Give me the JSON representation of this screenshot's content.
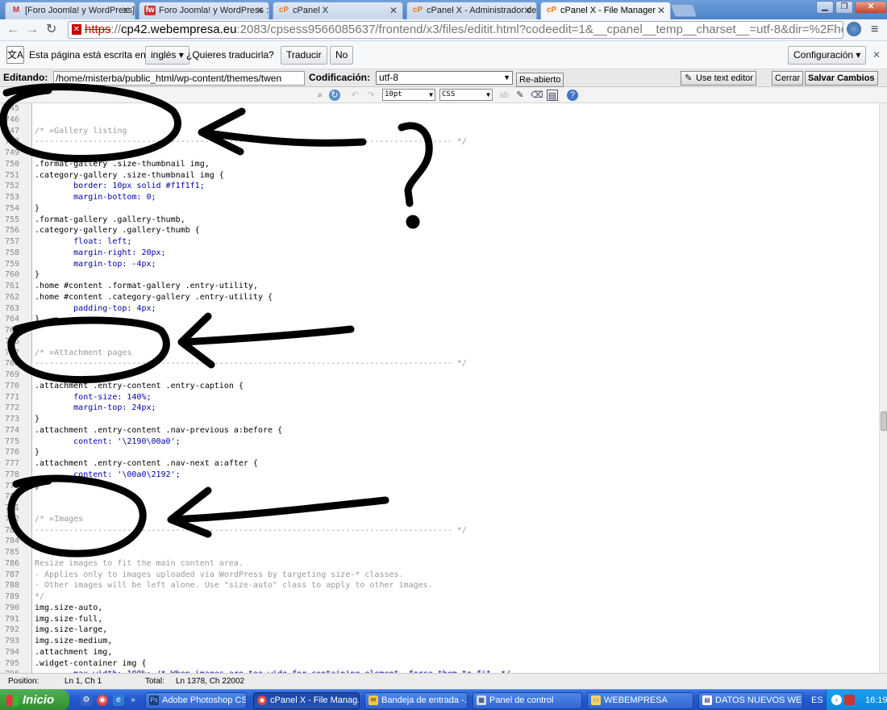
{
  "browser": {
    "tabs": [
      {
        "label": "[Foro Joomla! y WordPress]",
        "favicon": "gmail-icon"
      },
      {
        "label": "Foro Joomla! y WordPress ::",
        "favicon": "forum-icon"
      },
      {
        "label": "cPanel X",
        "favicon": "cpanel-icon"
      },
      {
        "label": "cPanel X - Administrador de /",
        "favicon": "cpanel-icon"
      },
      {
        "label": "cPanel X - File Manager",
        "favicon": "cpanel-icon"
      }
    ],
    "url": {
      "scheme": "https",
      "rest_before_host": "://",
      "host": "cp42.webempresa.eu",
      "path": ":2083/cpsess9566085637/frontend/x3/files/editit.html?codeedit=1&__cpanel__temp__charset__=utf-8&dir=%2Fhome%"
    }
  },
  "translate": {
    "message": "Esta página está escrita en",
    "language": "inglés",
    "question": "¿Quieres traducirla?",
    "translate_button": "Traducir",
    "no_button": "No",
    "config_button": "Configuración"
  },
  "editor_header": {
    "editing_label": "Editando:",
    "path": "/home/misterba/public_html/wp-content/themes/twen",
    "encoding_label": "Codificación:",
    "encoding": "utf-8",
    "reopen_button": "Re-abierto",
    "use_text_editor_button": "Use text editor",
    "close_button": "Cerrar",
    "save_button": "Salvar Cambios"
  },
  "toolbar": {
    "font_size": "10pt",
    "syntax": "CSS"
  },
  "code_lines": [
    {
      "n": "745",
      "t": "",
      "cls": ""
    },
    {
      "n": "746",
      "t": "",
      "cls": ""
    },
    {
      "n": "747",
      "t": "/* =Gallery listing",
      "cls": "c"
    },
    {
      "n": "748",
      "t": "-------------------------------------------------------------------------------------- */",
      "cls": "c"
    },
    {
      "n": "749",
      "t": "",
      "cls": ""
    },
    {
      "n": "750",
      "t": ".format-gallery .size-thumbnail img,",
      "cls": ""
    },
    {
      "n": "751",
      "t": ".category-gallery .size-thumbnail img {",
      "cls": ""
    },
    {
      "n": "752",
      "t": "        border: 10px solid #f1f1f1;",
      "cls": "p"
    },
    {
      "n": "753",
      "t": "        margin-bottom: 0;",
      "cls": "p"
    },
    {
      "n": "754",
      "t": "}",
      "cls": ""
    },
    {
      "n": "755",
      "t": ".format-gallery .gallery-thumb,",
      "cls": ""
    },
    {
      "n": "756",
      "t": ".category-gallery .gallery-thumb {",
      "cls": ""
    },
    {
      "n": "757",
      "t": "        float: left;",
      "cls": "p"
    },
    {
      "n": "758",
      "t": "        margin-right: 20px;",
      "cls": "p"
    },
    {
      "n": "759",
      "t": "        margin-top: -4px;",
      "cls": "p"
    },
    {
      "n": "760",
      "t": "}",
      "cls": ""
    },
    {
      "n": "761",
      "t": ".home #content .format-gallery .entry-utility,",
      "cls": ""
    },
    {
      "n": "762",
      "t": ".home #content .category-gallery .entry-utility {",
      "cls": ""
    },
    {
      "n": "763",
      "t": "        padding-top: 4px;",
      "cls": "p"
    },
    {
      "n": "764",
      "t": "}",
      "cls": ""
    },
    {
      "n": "765",
      "t": "",
      "cls": ""
    },
    {
      "n": "766",
      "t": "",
      "cls": ""
    },
    {
      "n": "767",
      "t": "/* =Attachment pages",
      "cls": "c"
    },
    {
      "n": "768",
      "t": "-------------------------------------------------------------------------------------- */",
      "cls": "c"
    },
    {
      "n": "769",
      "t": "",
      "cls": ""
    },
    {
      "n": "770",
      "t": ".attachment .entry-content .entry-caption {",
      "cls": ""
    },
    {
      "n": "771",
      "t": "        font-size: 140%;",
      "cls": "p"
    },
    {
      "n": "772",
      "t": "        margin-top: 24px;",
      "cls": "p"
    },
    {
      "n": "773",
      "t": "}",
      "cls": ""
    },
    {
      "n": "774",
      "t": ".attachment .entry-content .nav-previous a:before {",
      "cls": ""
    },
    {
      "n": "775",
      "t": "        content: '\\2190\\00a0';",
      "cls": "p"
    },
    {
      "n": "776",
      "t": "}",
      "cls": ""
    },
    {
      "n": "777",
      "t": ".attachment .entry-content .nav-next a:after {",
      "cls": ""
    },
    {
      "n": "778",
      "t": "        content: '\\00a0\\2192';",
      "cls": "p"
    },
    {
      "n": "779",
      "t": "}",
      "cls": ""
    },
    {
      "n": "780",
      "t": "",
      "cls": ""
    },
    {
      "n": "781",
      "t": "",
      "cls": ""
    },
    {
      "n": "782",
      "t": "/* =Images",
      "cls": "c"
    },
    {
      "n": "783",
      "t": "-------------------------------------------------------------------------------------- */",
      "cls": "c"
    },
    {
      "n": "784",
      "t": "",
      "cls": ""
    },
    {
      "n": "785",
      "t": "",
      "cls": ""
    },
    {
      "n": "786",
      "t": "Resize images to fit the main content area.",
      "cls": "c"
    },
    {
      "n": "787",
      "t": "- Applies only to images uploaded via WordPress by targeting size-* classes.",
      "cls": "c"
    },
    {
      "n": "788",
      "t": "- Other images will be left alone. Use \"size-auto\" class to apply to other images.",
      "cls": "c"
    },
    {
      "n": "789",
      "t": "*/",
      "cls": "c"
    },
    {
      "n": "790",
      "t": "img.size-auto,",
      "cls": ""
    },
    {
      "n": "791",
      "t": "img.size-full,",
      "cls": ""
    },
    {
      "n": "792",
      "t": "img.size-large,",
      "cls": ""
    },
    {
      "n": "793",
      "t": "img.size-medium,",
      "cls": ""
    },
    {
      "n": "794",
      "t": ".attachment img,",
      "cls": ""
    },
    {
      "n": "795",
      "t": ".widget-container img {",
      "cls": ""
    },
    {
      "n": "796",
      "t": "        max-width: 100%; /* When images are too wide for containing element, force them to fit. */",
      "cls": "p"
    }
  ],
  "statusbar": {
    "position_label": "Position:",
    "position": "Ln 1, Ch 1",
    "total_label": "Total:",
    "total": "Ln 1378, Ch 22002"
  },
  "taskbar": {
    "start_label": "Inicio",
    "tasks": [
      {
        "label": "Adobe Photoshop CS3",
        "icon": "photoshop-icon"
      },
      {
        "label": "cPanel X - File Manag...",
        "icon": "chrome-icon"
      },
      {
        "label": "Bandeja de entrada -...",
        "icon": "mail-icon"
      },
      {
        "label": "Panel de control",
        "icon": "control-panel-icon"
      },
      {
        "label": "WEBEMPRESA",
        "icon": "folder-icon"
      },
      {
        "label": "DATOS NUEVOS WEB...",
        "icon": "document-icon"
      }
    ],
    "language": "ES",
    "clock": "16:19"
  },
  "annotations": {
    "question_mark": "?",
    "color": "#000000"
  }
}
